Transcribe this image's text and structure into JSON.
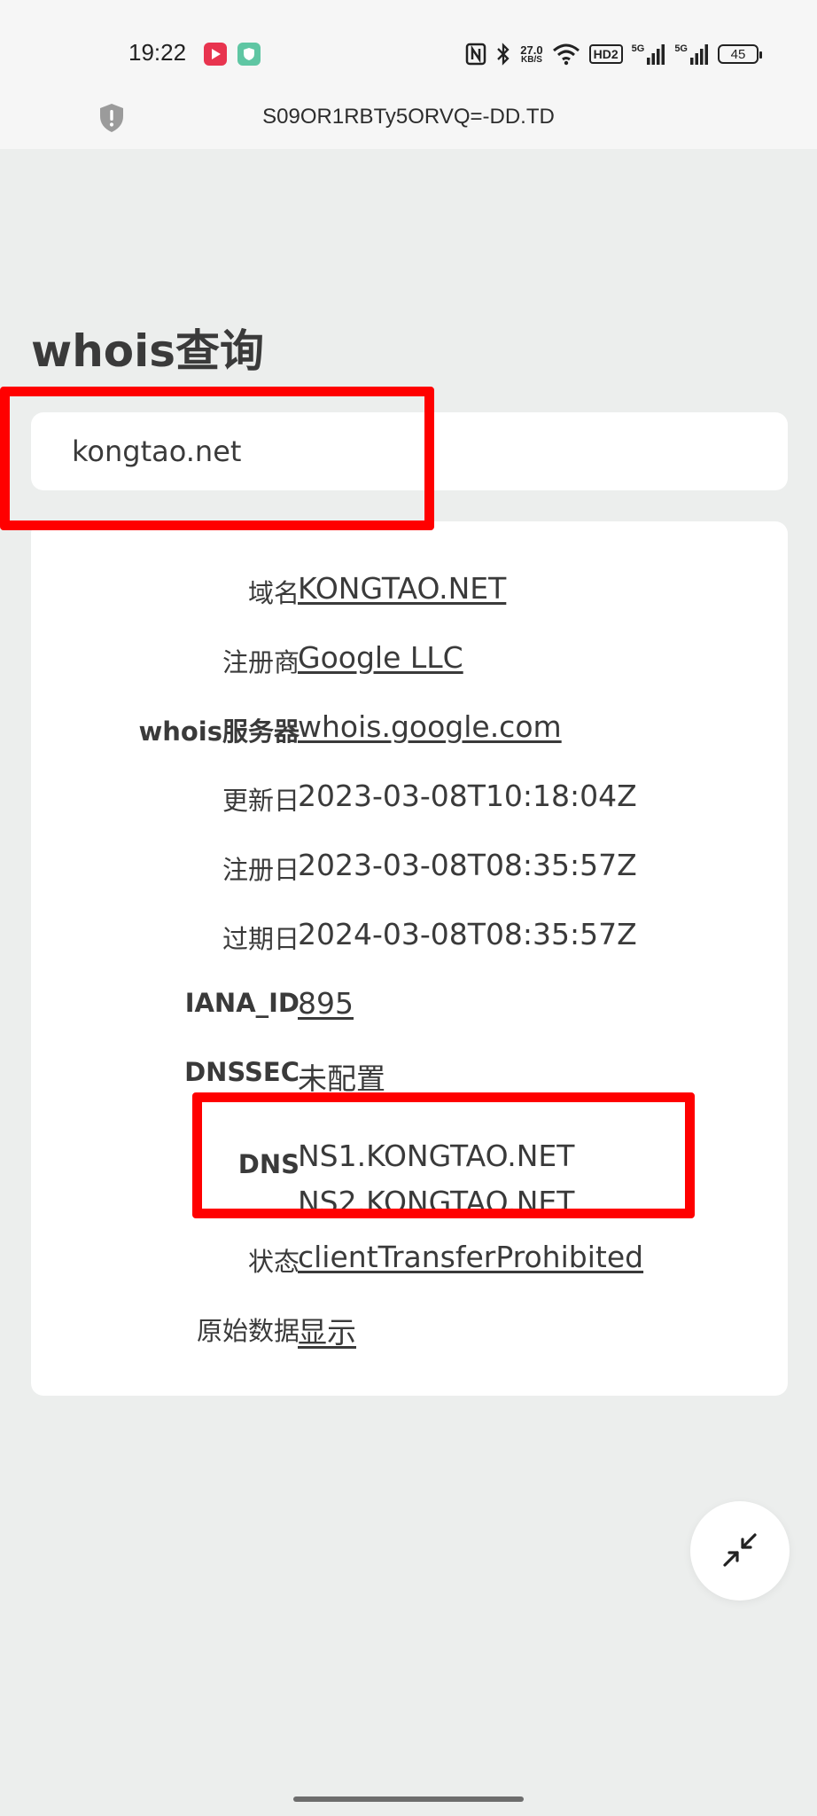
{
  "status_bar": {
    "time": "19:22",
    "net_speed_value": "27.0",
    "net_speed_unit": "KB/S",
    "hd_badge": "HD2",
    "signal1_label": "5G",
    "signal2_label": "5G",
    "battery": "45",
    "icons": [
      "nfc-icon",
      "bluetooth-icon",
      "wifi-icon",
      "signal-icon",
      "battery-icon"
    ]
  },
  "address_bar": {
    "url": "S09OR1RBTy5ORVQ=-DD.TD",
    "icon": "shield-icon"
  },
  "page": {
    "title": "whois查询"
  },
  "search": {
    "value": "kongtao.net"
  },
  "whois": {
    "rows": [
      {
        "label": "域名",
        "value": "KONGTAO.NET"
      },
      {
        "label": "注册商",
        "value": "Google LLC"
      },
      {
        "label": "whois服务器",
        "value": "whois.google.com"
      },
      {
        "label": "更新日",
        "value": "2023-03-08T10:18:04Z"
      },
      {
        "label": "注册日",
        "value": "2023-03-08T08:35:57Z"
      },
      {
        "label": "过期日",
        "value": "2024-03-08T08:35:57Z"
      },
      {
        "label": "IANA_ID",
        "value": "895"
      },
      {
        "label": "DNSSEC",
        "value": "未配置"
      },
      {
        "label": "DNS",
        "values": [
          "NS1.KONGTAO.NET",
          "NS2.KONGTAO.NET"
        ]
      },
      {
        "label": "状态",
        "value": "clientTransferProhibited"
      },
      {
        "label": "原始数据",
        "value": "显示"
      }
    ]
  },
  "colors": {
    "background": "#eceeed",
    "card": "#ffffff",
    "text": "#3a3a3a",
    "highlight": "#ff0000"
  },
  "fab_icon": "collapse-icon"
}
